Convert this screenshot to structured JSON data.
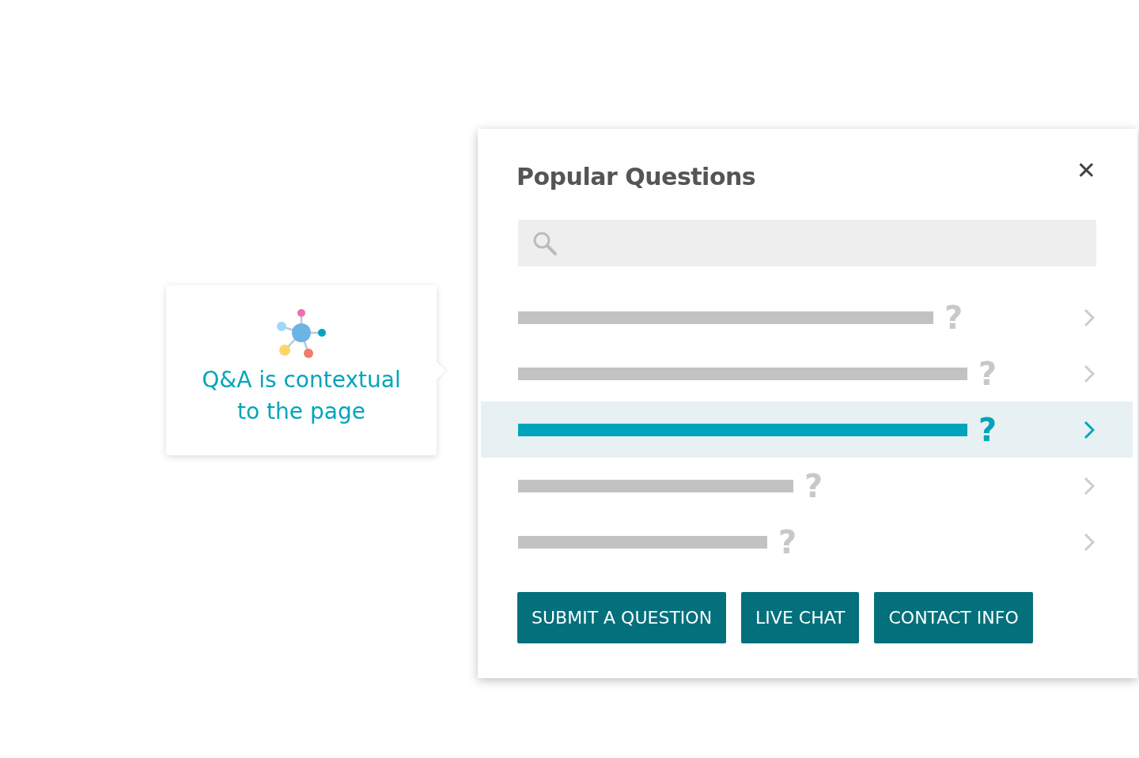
{
  "callout": {
    "text_lines": [
      "Q&A is contextual",
      "to the page"
    ]
  },
  "panel": {
    "title": "Popular Questions",
    "close": "✕",
    "questions": [
      {
        "mark": "?",
        "selected": false
      },
      {
        "mark": "?",
        "selected": false
      },
      {
        "mark": "?",
        "selected": true
      },
      {
        "mark": "?",
        "selected": false
      },
      {
        "mark": "?",
        "selected": false
      }
    ],
    "buttons": [
      "SUBMIT A QUESTION",
      "LIVE CHAT",
      "CONTACT INFO"
    ]
  }
}
